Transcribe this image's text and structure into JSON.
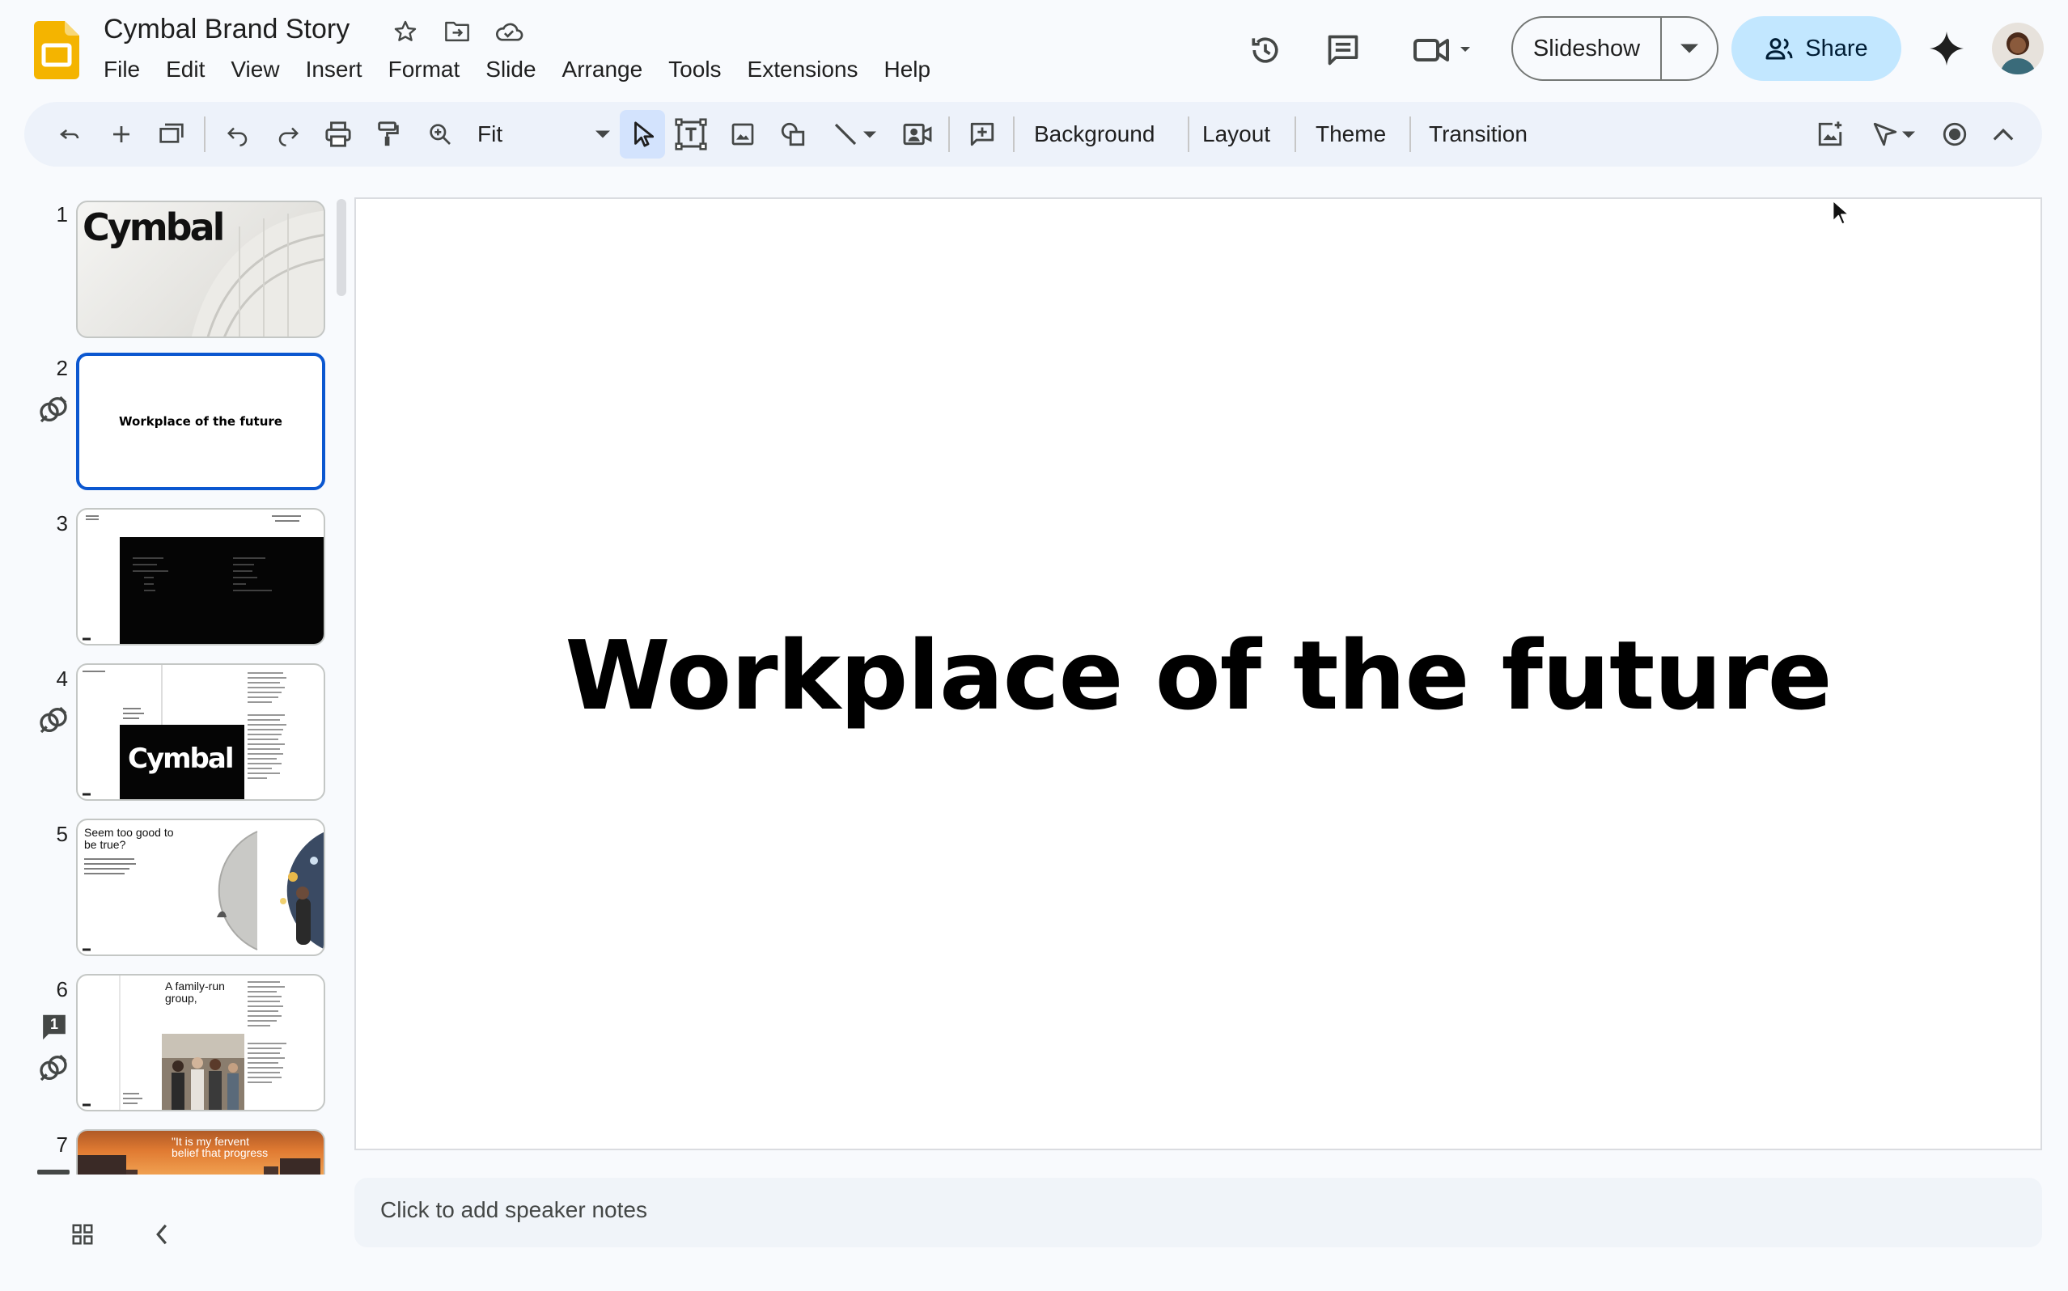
{
  "header": {
    "title": "Cymbal Brand Story",
    "menus": [
      "File",
      "Edit",
      "View",
      "Insert",
      "Format",
      "Slide",
      "Arrange",
      "Tools",
      "Extensions",
      "Help"
    ],
    "slideshow_label": "Slideshow",
    "share_label": "Share",
    "icons": [
      "star-icon",
      "move-to-folder-icon",
      "cloud-saved-icon",
      "version-history-icon",
      "comments-icon",
      "meet-icon",
      "gemini-icon"
    ]
  },
  "toolbar": {
    "zoom": "Fit",
    "background": "Background",
    "layout": "Layout",
    "theme": "Theme",
    "transition": "Transition"
  },
  "filmstrip": {
    "slides": [
      {
        "num": "1",
        "logo": "Cymbal"
      },
      {
        "num": "2",
        "title": "Workplace of the future"
      },
      {
        "num": "3"
      },
      {
        "num": "4",
        "logo": "Cymbal"
      },
      {
        "num": "5",
        "title": "Seem too good to be true?"
      },
      {
        "num": "6",
        "title": "A family-run group,",
        "comment_count": "1"
      },
      {
        "num": "7",
        "title": "\"It is my fervent belief that progress"
      }
    ]
  },
  "slide": {
    "title": "Workplace of the future"
  },
  "notes": {
    "placeholder": "Click to add speaker notes"
  },
  "colors": {
    "accent": "#0b57d0",
    "share_bg": "#c2e7ff",
    "app_yellow": "#f4b400",
    "toolbar_bg": "#edf2fa",
    "page_bg": "#f8fafd"
  }
}
